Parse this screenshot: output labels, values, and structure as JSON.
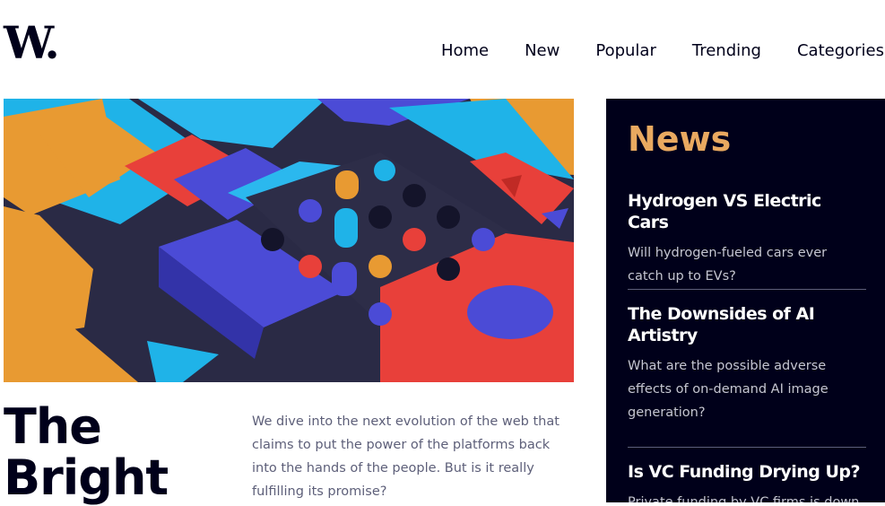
{
  "brand": {
    "logo_text": "W."
  },
  "nav": {
    "items": [
      "Home",
      "New",
      "Popular",
      "Trending",
      "Categories"
    ]
  },
  "main": {
    "headline": "The Bright",
    "intro": "We dive into the next evolution of the web that claims to put the power of the platforms back into the hands of the people. But is it really fulfilling its promise?"
  },
  "news": {
    "title": "News",
    "items": [
      {
        "title": "Hydrogen VS Electric Cars",
        "summary": "Will hydrogen-fueled cars ever catch up to EVs?"
      },
      {
        "title": "The Downsides of AI Artistry",
        "summary": "What are the possible adverse effects of on-demand AI image generation?"
      },
      {
        "title": "Is VC Funding Drying Up?",
        "summary": "Private funding by VC firms is down"
      }
    ]
  },
  "colors": {
    "dark": "#00001a",
    "accent": "#e9a960",
    "text_muted": "#5d5f79",
    "news_text": "#c5c6d0"
  }
}
